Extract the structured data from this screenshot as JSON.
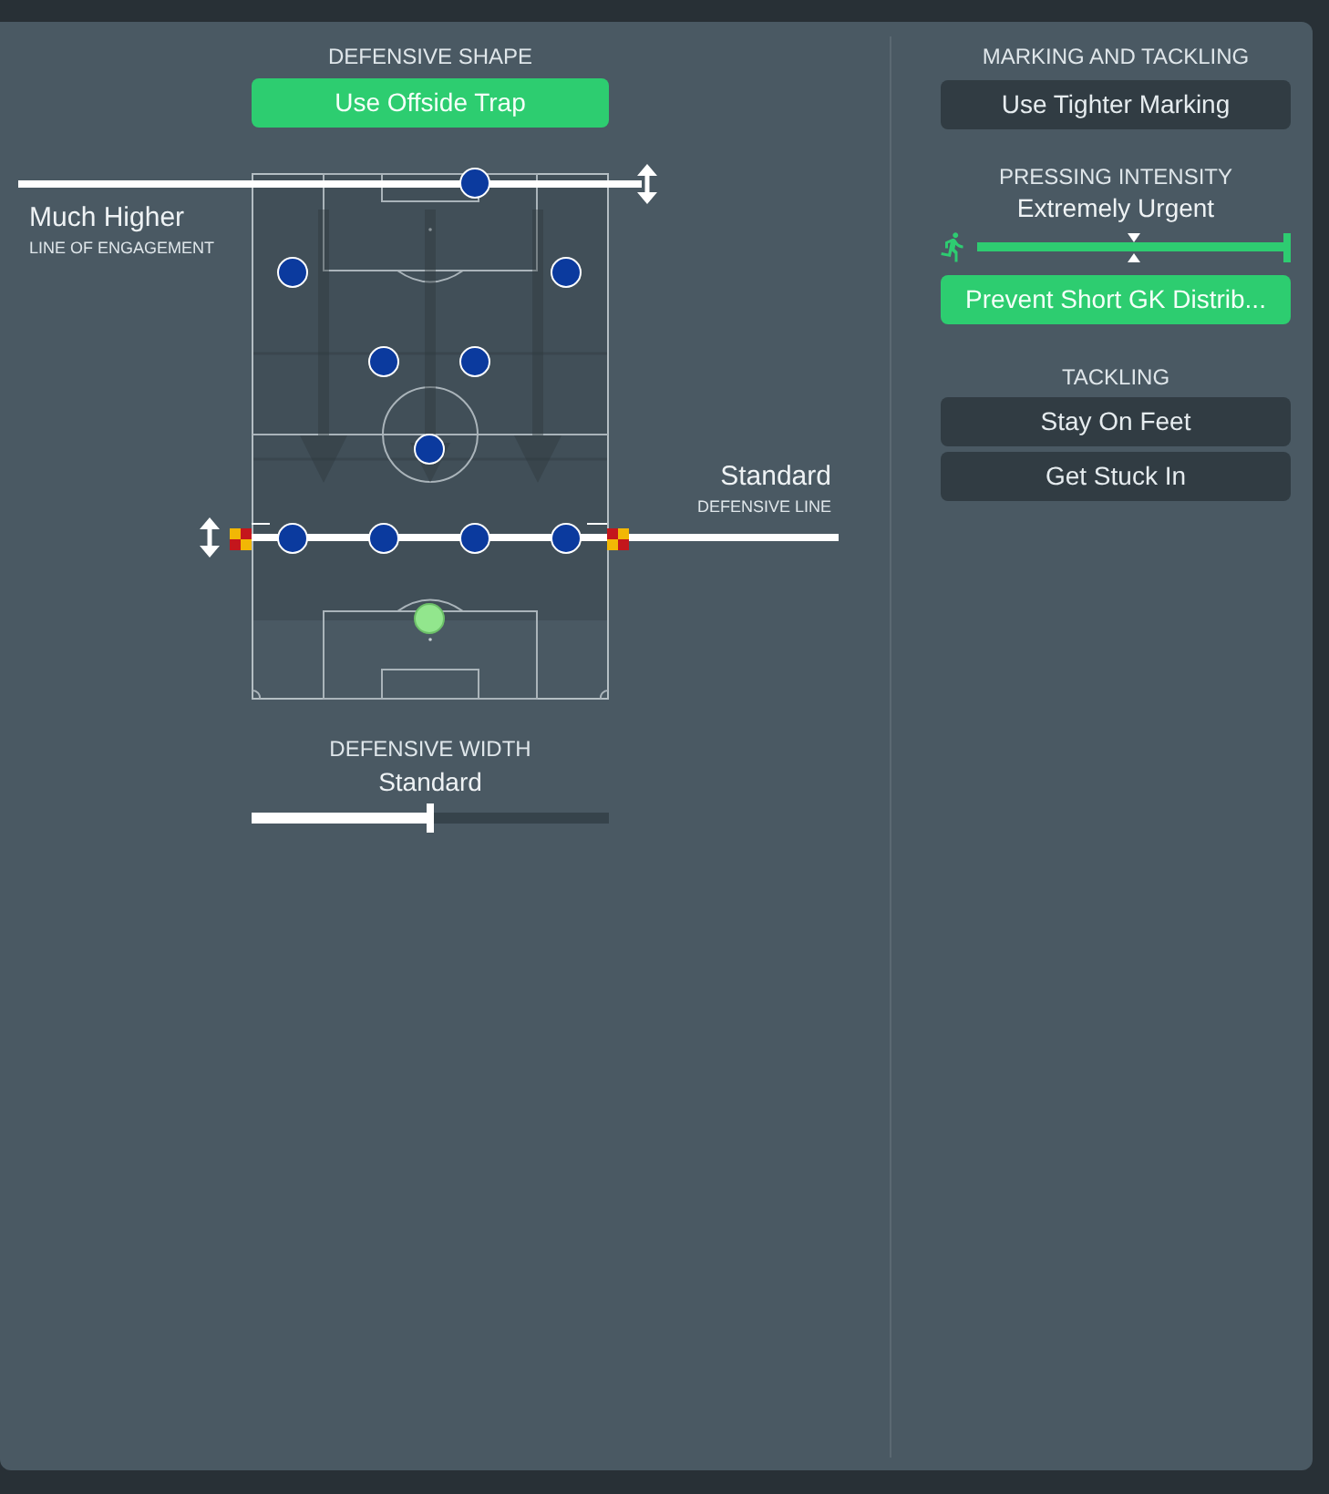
{
  "left_panel": {
    "defensive_shape": {
      "heading": "DEFENSIVE SHAPE",
      "offside_trap": {
        "label": "Use Offside Trap",
        "on": true
      }
    },
    "line_of_engagement": {
      "value": "Much Higher",
      "label": "LINE OF ENGAGEMENT"
    },
    "defensive_line": {
      "value": "Standard",
      "label": "DEFENSIVE LINE"
    },
    "players": [
      {
        "kind": "outfield"
      },
      {
        "kind": "outfield"
      },
      {
        "kind": "outfield"
      },
      {
        "kind": "outfield"
      },
      {
        "kind": "outfield"
      },
      {
        "kind": "outfield"
      },
      {
        "kind": "outfield"
      },
      {
        "kind": "outfield"
      },
      {
        "kind": "outfield"
      },
      {
        "kind": "outfield"
      },
      {
        "kind": "goalkeeper"
      }
    ],
    "defensive_width": {
      "heading": "DEFENSIVE WIDTH",
      "value": "Standard",
      "level": 0.5
    }
  },
  "right_panel": {
    "marking_and_tackling": {
      "heading": "MARKING AND TACKLING",
      "tighter_marking": {
        "label": "Use Tighter Marking",
        "on": false
      }
    },
    "pressing_intensity": {
      "heading": "PRESSING INTENSITY",
      "value": "Extremely Urgent",
      "level": 1,
      "gk_distribution": {
        "label": "Prevent Short GK Distrib...",
        "on": true
      }
    },
    "tackling": {
      "heading": "TACKLING",
      "options": [
        {
          "label": "Stay On Feet",
          "selected": false
        },
        {
          "label": "Get Stuck In",
          "selected": false
        }
      ]
    }
  }
}
